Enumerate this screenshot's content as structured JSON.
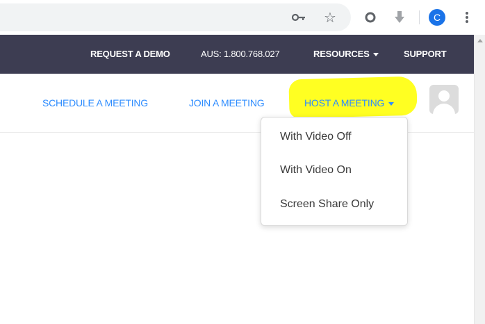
{
  "browser": {
    "icons": [
      "key-icon",
      "star-icon",
      "extension-icon",
      "download-icon",
      "profile-icon",
      "menu-icon"
    ],
    "profile_letter": "C",
    "accent": "#1a73e8"
  },
  "top_nav": {
    "request_demo": "REQUEST A DEMO",
    "phone": "AUS: 1.800.768.027",
    "resources": "RESOURCES",
    "support": "SUPPORT",
    "bg_color": "#3d3d52"
  },
  "main_nav": {
    "schedule": "SCHEDULE A MEETING",
    "join": "JOIN A MEETING",
    "host": "HOST A MEETING",
    "link_color": "#2d8cff",
    "highlight_color": "#ffff22"
  },
  "host_menu": {
    "options": [
      "With Video Off",
      "With Video On",
      "Screen Share Only"
    ]
  }
}
